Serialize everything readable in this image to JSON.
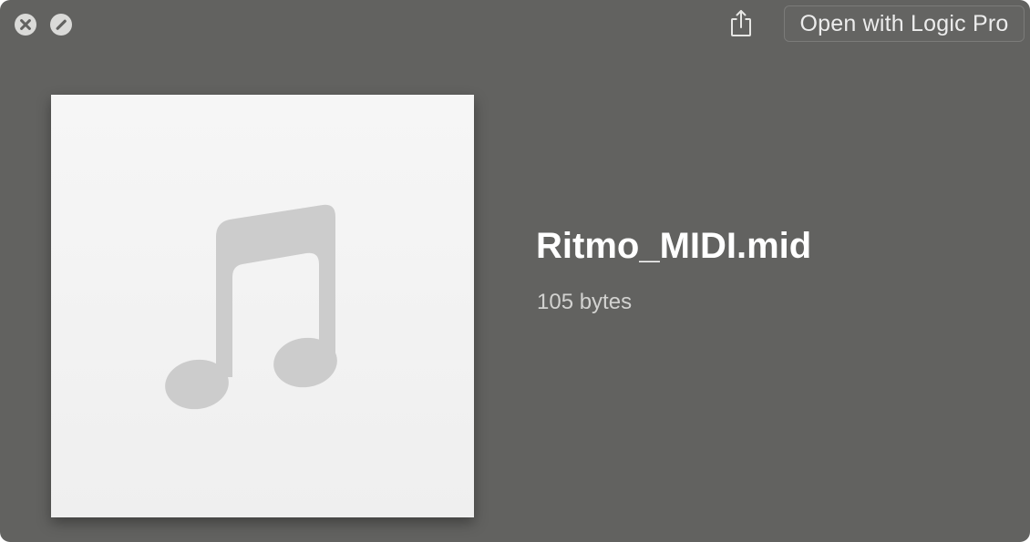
{
  "toolbar": {
    "close_icon": "close-icon",
    "fullscreen_icon": "fullscreen-icon",
    "share_icon": "share-icon",
    "open_with_label": "Open with Logic Pro"
  },
  "preview": {
    "thumbnail_icon": "music-note-icon",
    "file_name": "Ritmo_MIDI.mid",
    "file_size": "105 bytes"
  },
  "colors": {
    "window_background": "#626260",
    "thumbnail_background": "#f2f2f2",
    "note_glyph": "#cccccc",
    "button_border": "#7b7b79"
  }
}
